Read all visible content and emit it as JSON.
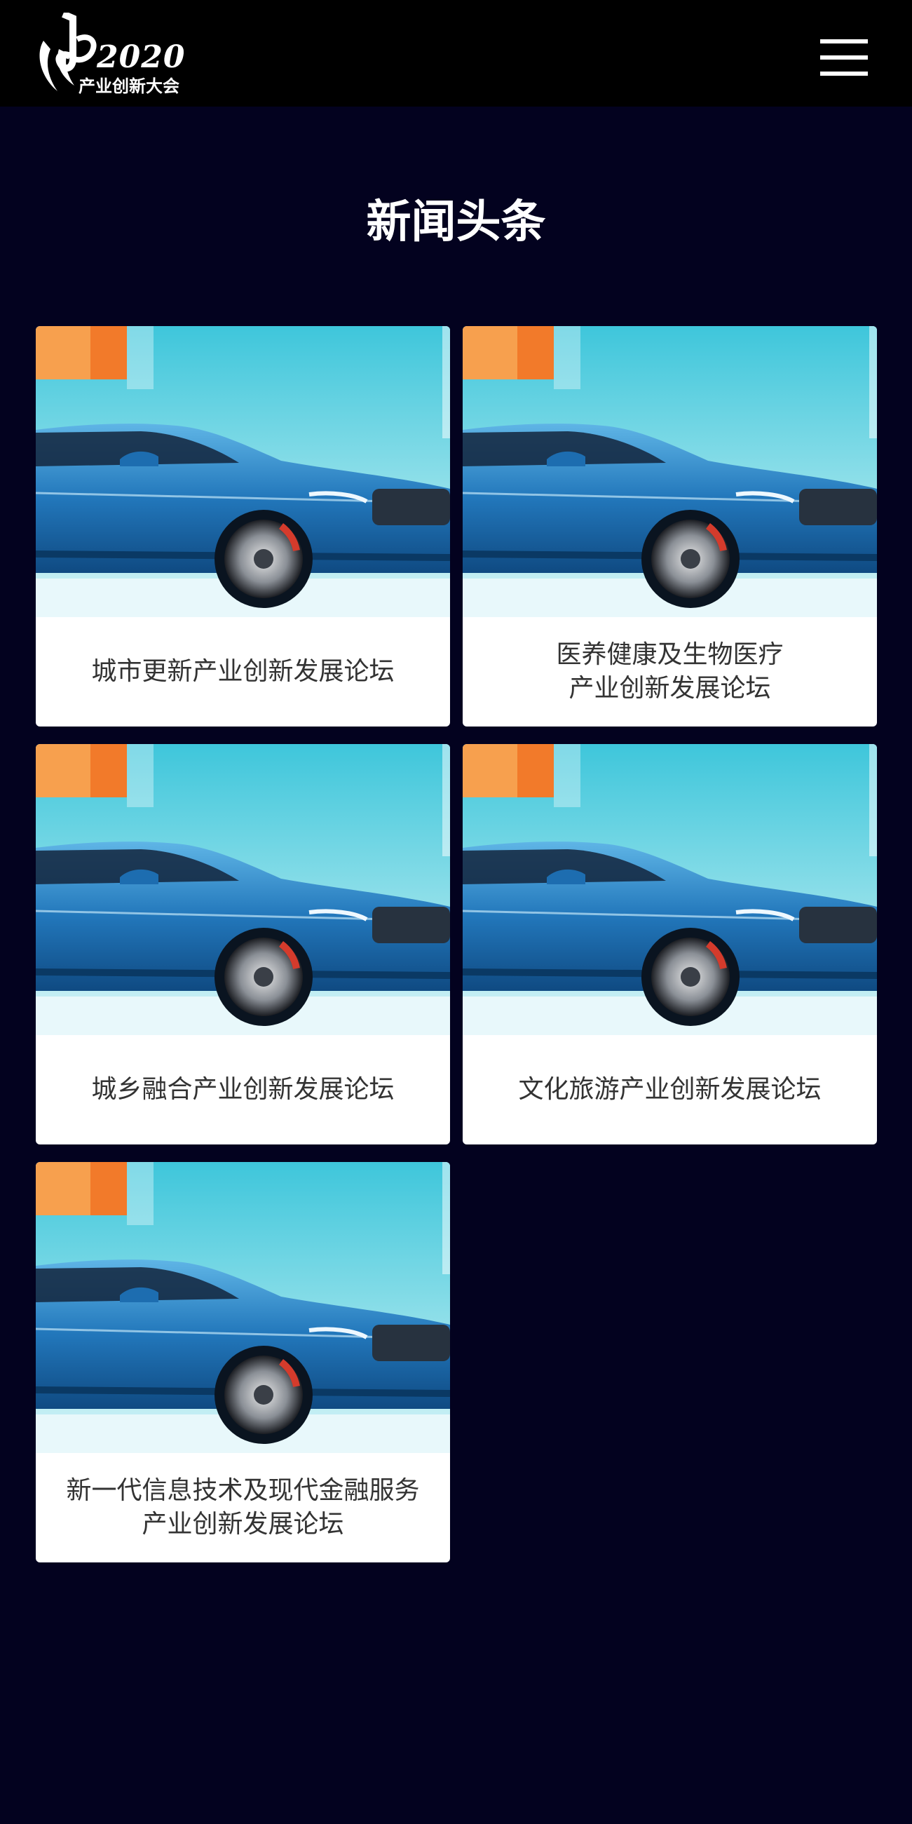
{
  "header": {
    "logo": {
      "year": "2020",
      "subtitle": "产业创新大会"
    },
    "menu_icon": "hamburger-menu-icon"
  },
  "page": {
    "title": "新闻头条"
  },
  "cards": [
    {
      "title": "城市更新产业创新发展论坛"
    },
    {
      "title": "医养健康及生物医疗\n产业创新发展论坛"
    },
    {
      "title": "城乡融合产业创新发展论坛"
    },
    {
      "title": "文化旅游产业创新发展论坛"
    },
    {
      "title": "新一代信息技术及现代金融服务\n产业创新发展论坛"
    }
  ],
  "colors": {
    "background": "#03021f",
    "header": "#000000",
    "card": "#ffffff",
    "caption_text": "#333333"
  }
}
